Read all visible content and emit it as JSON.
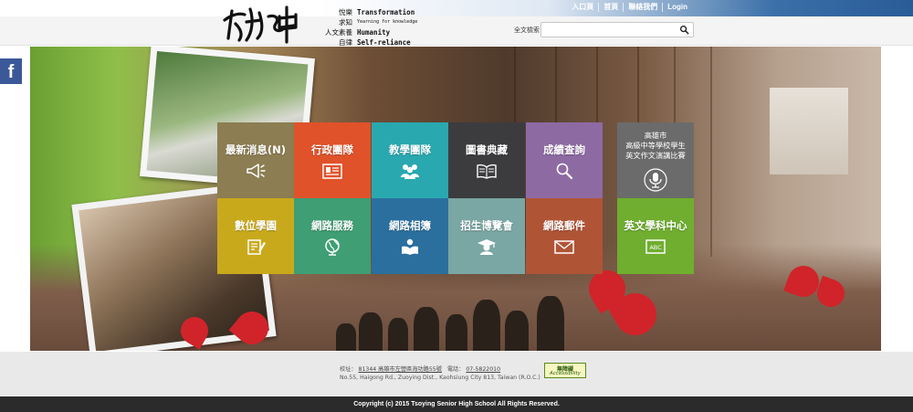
{
  "header": {
    "logo_chinese_lines": [
      "悅樂",
      "求知",
      "人文素養",
      "自律"
    ],
    "logo_english_lines": [
      "Transformation",
      "Yearning for knowledge",
      "Humanity",
      "Self-reliance"
    ],
    "top_links": [
      "入口頁",
      "首頁",
      "聯絡我們",
      "Login"
    ],
    "search_label": "全文檢索",
    "search_placeholder": "",
    "colors": {
      "top_gradient_end": "#2a5c97"
    }
  },
  "tiles": [
    {
      "label": "最新消息(N)",
      "icon": "megaphone-icon",
      "color": "#8c7d52"
    },
    {
      "label": "行政團隊",
      "icon": "id-card-icon",
      "color": "#e0522a"
    },
    {
      "label": "教學團隊",
      "icon": "people-icon",
      "color": "#2aa8b0"
    },
    {
      "label": "圖書典藏",
      "icon": "open-book-icon",
      "color": "#3c3c3f"
    },
    {
      "label": "成績查詢",
      "icon": "magnifier-icon",
      "color": "#8e6aa3"
    },
    {
      "label": "高雄市\n高級中等學校學生\n英文作文演講比賽",
      "icon": "microphone-icon",
      "color": "#6b6b6b"
    },
    {
      "label": "數位學園",
      "icon": "notepad-pencil-icon",
      "color": "#c9a91c"
    },
    {
      "label": "網路服務",
      "icon": "globe-icon",
      "color": "#3f9e73"
    },
    {
      "label": "網路相簿",
      "icon": "person-reading-icon",
      "color": "#2a6f9e"
    },
    {
      "label": "招生博覽會",
      "icon": "graduate-icon",
      "color": "#7aa6a3"
    },
    {
      "label": "網路郵件",
      "icon": "envelope-icon",
      "color": "#b05436"
    },
    {
      "label": "英文學科中心",
      "icon": "abc-board-icon",
      "color": "#6fae2f"
    }
  ],
  "social": {
    "facebook_label": "f"
  },
  "footer": {
    "address_prefix": "校址：",
    "address": "81344 高雄市左營區海功路55號",
    "phone_prefix": "電話：",
    "phone": "07-5822010",
    "address_en": "No.55, Haigong Rd., Zuoying Dist., Kaohsiung City 813, Taiwan (R.O.C.)",
    "a11y_badge_top": "無障礙",
    "a11y_badge_bottom": "Accessibility",
    "copyright": "Copyright (c) 2015 Tsoying Senior High School All Rights Reserved."
  }
}
